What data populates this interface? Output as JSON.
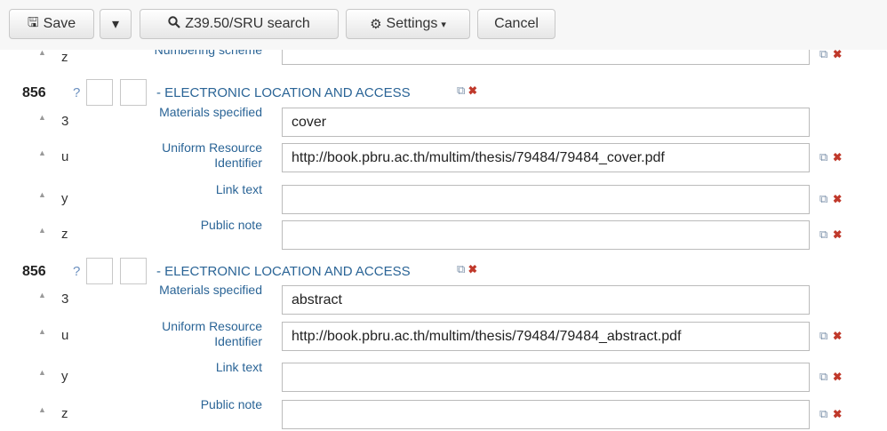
{
  "toolbar": {
    "save_label": "Save",
    "save_icon": "floppy-icon",
    "dropdown_caret": "▾",
    "search_label": "Z39.50/SRU search",
    "search_icon": "magnifier-icon",
    "settings_label": "Settings",
    "settings_icon": "gear-icon",
    "cancel_label": "Cancel"
  },
  "partial_row": {
    "code": "z",
    "label": "Numbering scheme"
  },
  "fields": [
    {
      "tag": "856",
      "help": "?",
      "description": "- ELECTRONIC LOCATION AND ACCESS",
      "subfields": [
        {
          "code": "3",
          "label": "Materials specified",
          "value": "cover",
          "icons": false
        },
        {
          "code": "u",
          "label": "Uniform Resource Identifier",
          "value": "http://book.pbru.ac.th/multim/thesis/79484/79484_cover.pdf",
          "icons": true
        },
        {
          "code": "y",
          "label": "Link text",
          "value": "",
          "icons": true
        },
        {
          "code": "z",
          "label": "Public note",
          "value": "",
          "icons": true
        }
      ]
    },
    {
      "tag": "856",
      "help": "?",
      "description": "- ELECTRONIC LOCATION AND ACCESS",
      "subfields": [
        {
          "code": "3",
          "label": "Materials specified",
          "value": "abstract",
          "icons": false
        },
        {
          "code": "u",
          "label": "Uniform Resource Identifier",
          "value": "http://book.pbru.ac.th/multim/thesis/79484/79484_abstract.pdf",
          "icons": true
        },
        {
          "code": "y",
          "label": "Link text",
          "value": "",
          "icons": true
        },
        {
          "code": "z",
          "label": "Public note",
          "value": "",
          "icons": true
        }
      ]
    }
  ]
}
